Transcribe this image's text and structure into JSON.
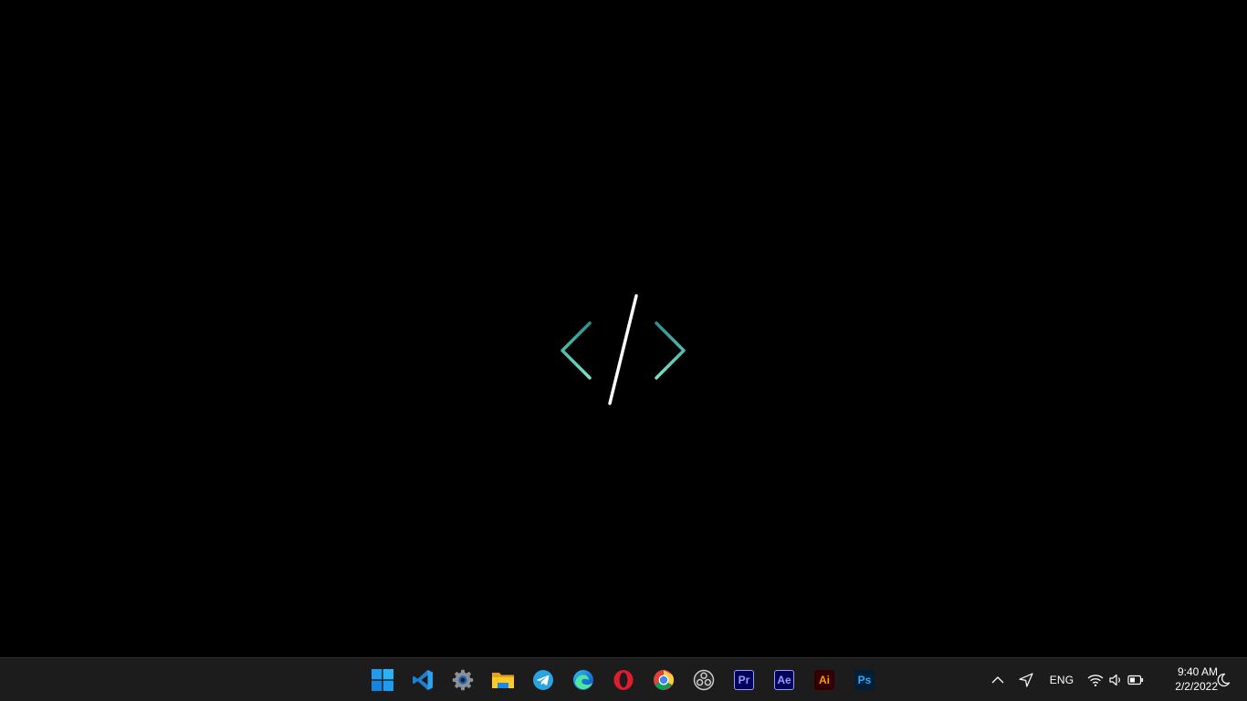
{
  "taskbar": {
    "apps": [
      {
        "name": "Start",
        "icon": "windows-start-icon"
      },
      {
        "name": "Visual Studio Code",
        "icon": "vscode-icon"
      },
      {
        "name": "Settings",
        "icon": "settings-gear-icon"
      },
      {
        "name": "File Explorer",
        "icon": "folder-icon"
      },
      {
        "name": "Telegram",
        "icon": "telegram-icon"
      },
      {
        "name": "Microsoft Edge",
        "icon": "edge-icon"
      },
      {
        "name": "Opera",
        "icon": "opera-icon"
      },
      {
        "name": "Google Chrome",
        "icon": "chrome-icon"
      },
      {
        "name": "OBS Studio",
        "icon": "obs-icon"
      },
      {
        "name": "Adobe Premiere Pro",
        "icon": "premiere-icon",
        "label": "Pr"
      },
      {
        "name": "Adobe After Effects",
        "icon": "after-effects-icon",
        "label": "Ae"
      },
      {
        "name": "Adobe Illustrator",
        "icon": "illustrator-icon",
        "label": "Ai"
      },
      {
        "name": "Adobe Photoshop",
        "icon": "photoshop-icon",
        "label": "Ps"
      }
    ],
    "tray": {
      "language": "ENG",
      "time": "9:40 AM",
      "date": "2/2/2022",
      "icons": [
        "chevron-up-icon",
        "location-arrow-icon",
        "wifi-icon",
        "volume-icon",
        "battery-icon",
        "moon-icon"
      ]
    }
  },
  "colors": {
    "taskbar_bg": "#1c1c1c",
    "logo_teal": "#3fb8b0",
    "logo_slash": "#ffffff",
    "premiere": "#9999ff",
    "after_effects": "#9999ff",
    "illustrator": "#ff9a00",
    "photoshop": "#31a8ff"
  }
}
